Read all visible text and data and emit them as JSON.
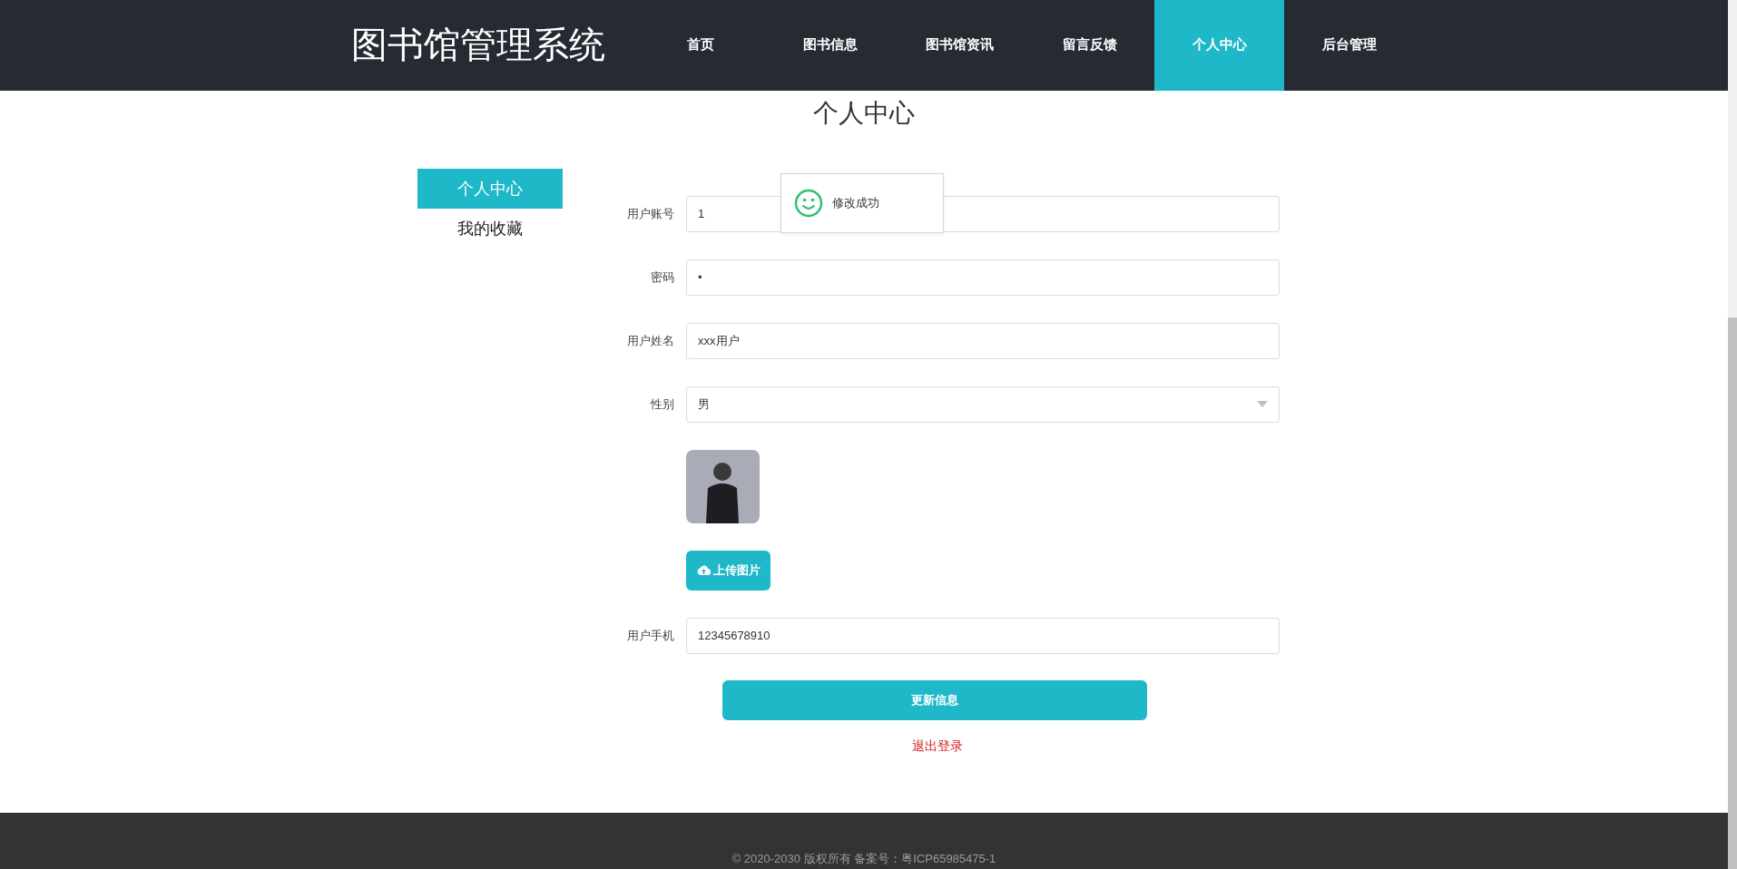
{
  "header": {
    "site_title": "图书馆管理系统",
    "nav": [
      {
        "label": "首页",
        "selected": false
      },
      {
        "label": "图书信息",
        "selected": false
      },
      {
        "label": "图书馆资讯",
        "selected": false
      },
      {
        "label": "留言反馈",
        "selected": false
      },
      {
        "label": "个人中心",
        "selected": true
      },
      {
        "label": "后台管理",
        "selected": false
      }
    ]
  },
  "page_title": "个人中心",
  "sidebar": {
    "items": [
      {
        "label": "个人中心",
        "selected": true
      },
      {
        "label": "我的收藏",
        "selected": false
      }
    ]
  },
  "form": {
    "fields": [
      {
        "kind": "text",
        "label": "用户账号",
        "value": "1"
      },
      {
        "kind": "text",
        "label": "密码",
        "value": "•"
      },
      {
        "kind": "text",
        "label": "用户姓名",
        "value": "xxx用户"
      },
      {
        "kind": "select",
        "label": "性别",
        "value": "男"
      },
      {
        "kind": "image"
      },
      {
        "kind": "upload",
        "button": "上传图片"
      },
      {
        "kind": "text",
        "label": "用户手机",
        "value": "12345678910"
      }
    ],
    "submit": "更新信息",
    "logout": "退出登录"
  },
  "toast": {
    "message": "修改成功"
  },
  "footer": {
    "text": "© 2020-2030 版权所有 备案号：粤ICP65985475-1"
  }
}
